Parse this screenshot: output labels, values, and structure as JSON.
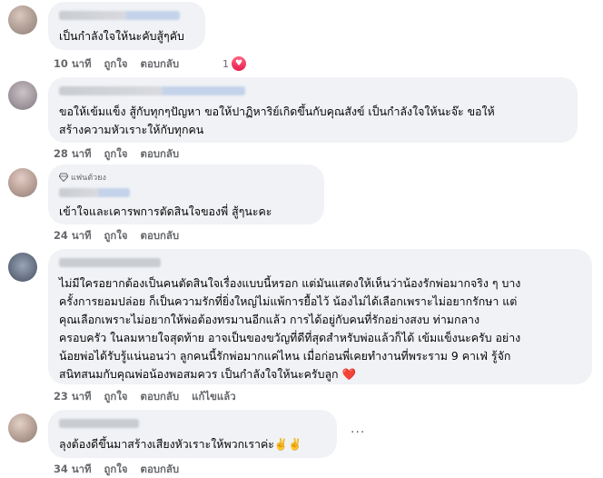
{
  "comments": [
    {
      "text": "เป็นกำลังใจให้นะคับสู้ๆคับ",
      "time": "10 นาที",
      "like": "ถูกใจ",
      "reply": "ตอบกลับ",
      "reaction_count": "1",
      "reaction_icon": "love-reaction"
    },
    {
      "text": "ขอให้เข้มแข็ง สู้กับทุกๆปัญหา ขอให้ปาฏิหาริย์เกิดขึ้นกับคุณสังข์ เป็นกำลังใจให้นะจ๊ะ ขอให้\nสร้างความหัวเราะให้กับทุกคน",
      "time": "28 นาที",
      "like": "ถูกใจ",
      "reply": "ตอบกลับ"
    },
    {
      "badge": "แฟนตัวยง",
      "badge_icon": "diamond-icon",
      "text": "เข้าใจและเคารพการตัดสินใจของพี่ สู้ๆนะคะ",
      "time": "24 นาที",
      "like": "ถูกใจ",
      "reply": "ตอบกลับ"
    },
    {
      "text": "ไม่มีใครอยากต้องเป็นคนตัดสินใจเรื่องแบบนี้หรอก แต่มันแสดงให้เห็นว่าน้องรักพ่อมากจริง ๆ บาง\nครั้งการยอมปล่อย ก็เป็นความรักที่ยิ่งใหญ่ไม่แพ้การยื้อไว้ น้องไม่ได้เลือกเพราะไม่อยากรักษา แต่\nคุณเลือกเพราะไม่อยากให้พ่อต้องทรมานอีกแล้ว การได้อยู่กับคนที่รักอย่างสงบ ท่ามกลาง\nครอบครัว ในลมหายใจสุดท้าย อาจเป็นของขวัญที่ดีที่สุดสำหรับพ่อแล้วก็ได้ เข้มแข็งนะครับ อย่าง\nน้อยพ่อได้รับรู้แน่นอนว่า ลูกคนนี้รักพ่อมากแค่ไหน เมื่อก่อนพี่เคยทำงานที่พระราม 9 คาเฟ่ รู้จัก\nสนิทสนมกับคุณพ่อน้องพอสมควร เป็นกำลังใจให้นะครับลูก ❤️",
      "time": "23 นาที",
      "like": "ถูกใจ",
      "reply": "ตอบกลับ",
      "edited": "แก้ไขแล้ว"
    },
    {
      "text": "ลุงต้องดีขึ้นมาสร้างเสียงหัวเราะให้พวกเราค่ะ✌️✌️",
      "time": "34 นาที",
      "like": "ถูกใจ",
      "reply": "ตอบกลับ",
      "more_icon": "more-options-icon"
    }
  ],
  "colors": {
    "bubble": "#f0f2f5",
    "text": "#050505",
    "meta": "#65676b",
    "love": "#f0284a"
  }
}
